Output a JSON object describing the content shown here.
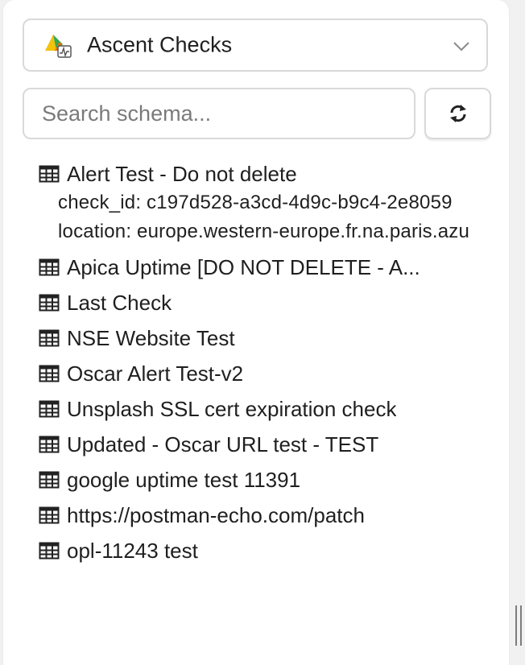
{
  "datasource": {
    "name": "Ascent Checks",
    "logo_icon": "ascent-logo-icon",
    "chevron_icon": "chevron-down-icon"
  },
  "search": {
    "placeholder": "Search schema...",
    "value": ""
  },
  "refresh_icon": "refresh-icon",
  "schema_items": [
    {
      "label": "Alert Test - Do not delete",
      "expanded": true,
      "details": [
        "check_id: c197d528-a3cd-4d9c-b9c4-2e8059",
        "location: europe.western-europe.fr.na.paris.azu"
      ]
    },
    {
      "label": "Apica Uptime [DO NOT DELETE - A..."
    },
    {
      "label": "Last Check"
    },
    {
      "label": "NSE Website Test"
    },
    {
      "label": "Oscar Alert Test-v2"
    },
    {
      "label": "Unsplash SSL cert expiration check"
    },
    {
      "label": "Updated - Oscar URL test - TEST"
    },
    {
      "label": "google uptime test 11391"
    },
    {
      "label": "https://postman-echo.com/patch"
    },
    {
      "label": "opl-11243 test"
    }
  ],
  "colors": {
    "border": "#d9d9d9",
    "text": "#1f1f1f",
    "placeholder": "#7a7a7a",
    "logo_yellow": "#f4c20d",
    "logo_green": "#34a853",
    "logo_orange": "#e8710a"
  }
}
